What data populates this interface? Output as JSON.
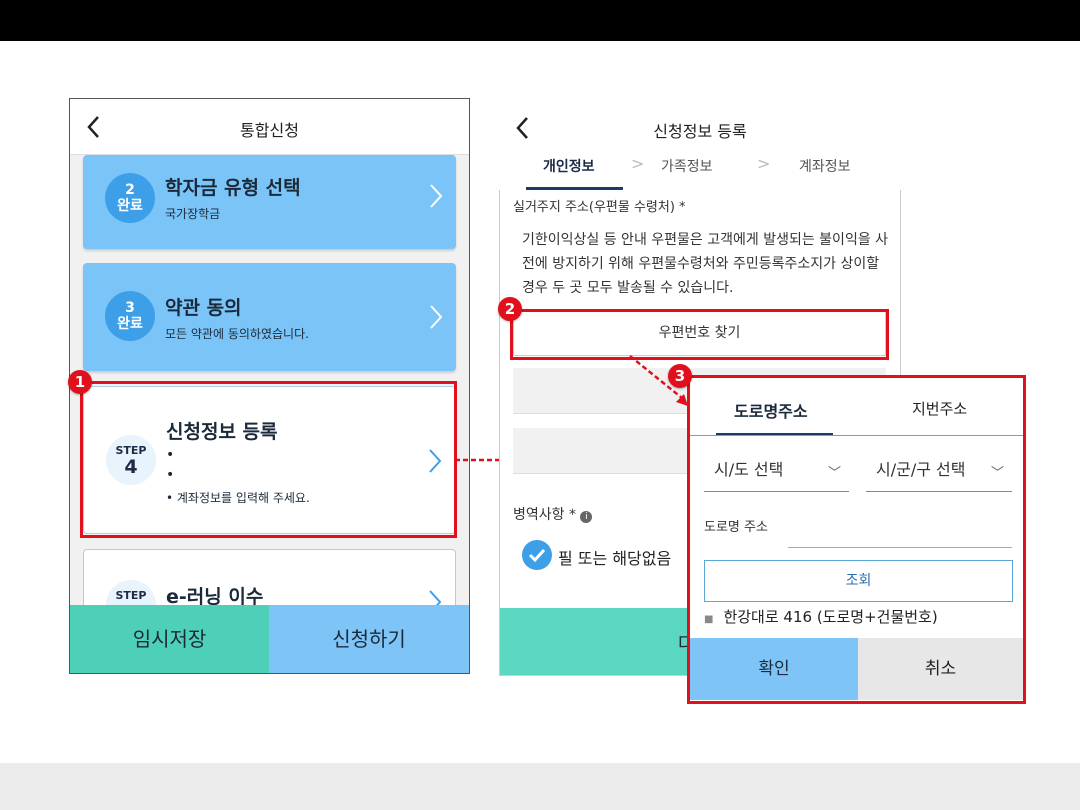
{
  "left_screen": {
    "title": "통합신청",
    "cards": [
      {
        "badge_top": "2",
        "badge_bottom": "완료",
        "title": "학자금 유형 선택",
        "subtitle": "국가장학금"
      },
      {
        "badge_top": "3",
        "badge_bottom": "완료",
        "title": "약관 동의",
        "subtitle": "모든 약관에 동의하였습니다."
      },
      {
        "badge_top": "STEP",
        "badge_bottom": "4",
        "title": "신청정보 등록",
        "lines": [
          "•",
          "•",
          "•  계좌정보를 입력해 주세요."
        ]
      },
      {
        "badge_top": "STEP",
        "title": "e-러닝 이수"
      }
    ],
    "buttons": {
      "save": "임시저장",
      "apply": "신청하기"
    }
  },
  "middle_screen": {
    "title": "신청정보 등록",
    "tabs": [
      "개인정보",
      "가족정보",
      "계좌정보"
    ],
    "tab_sep": ">",
    "address_label": "실거주지 주소(우편물 수령처) *",
    "info_text": "기한이익상실 등 안내 우편물은 고객에게 발생되는 불이익을 사전에 방지하기 위해 우편물수령처와 주민등록주소지가 상이할 경우 두 곳 모두 발송될 수 있습니다.",
    "zip_button": "우편번호 찾기",
    "military_label": "병역사항 *",
    "checkbox_label": "필 또는 해당없음",
    "bottom_label": "다"
  },
  "popup": {
    "tabs": [
      "도로명주소",
      "지번주소"
    ],
    "select_city": "시/도 선택",
    "select_district": "시/군/구 선택",
    "road_label": "도로명 주소",
    "search_button": "조회",
    "result": "한강대로 416 (도로명+건물번호)",
    "ok": "확인",
    "cancel": "취소"
  },
  "markers": [
    "1",
    "2",
    "3"
  ],
  "colors": {
    "highlight": "#e0101c",
    "primary_blue": "#7bc4f7",
    "teal": "#4ecfb7"
  }
}
